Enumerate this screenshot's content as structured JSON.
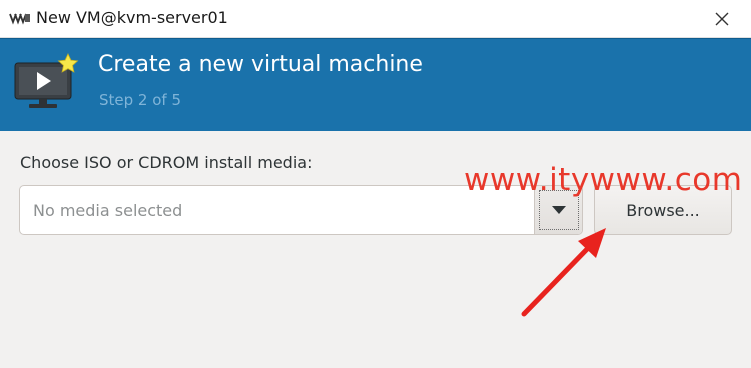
{
  "window": {
    "title": "New VM@kvm-server01",
    "app_icon": "virt-manager-logo-icon",
    "close_icon": "close-icon"
  },
  "header": {
    "icon": "new-vm-monitor-icon",
    "title": "Create a new virtual machine",
    "subtitle": "Step 2 of 5",
    "background_color": "#1a72ab"
  },
  "install_media": {
    "label": "Choose ISO or CDROM install media:",
    "placeholder": "No media selected",
    "value": "",
    "dropdown_icon": "chevron-down-icon",
    "browse_label": "Browse..."
  },
  "overlay": {
    "watermark_text": "www.itywww.com",
    "watermark_color": "#e8382b",
    "arrow_icon": "red-arrow-icon"
  }
}
